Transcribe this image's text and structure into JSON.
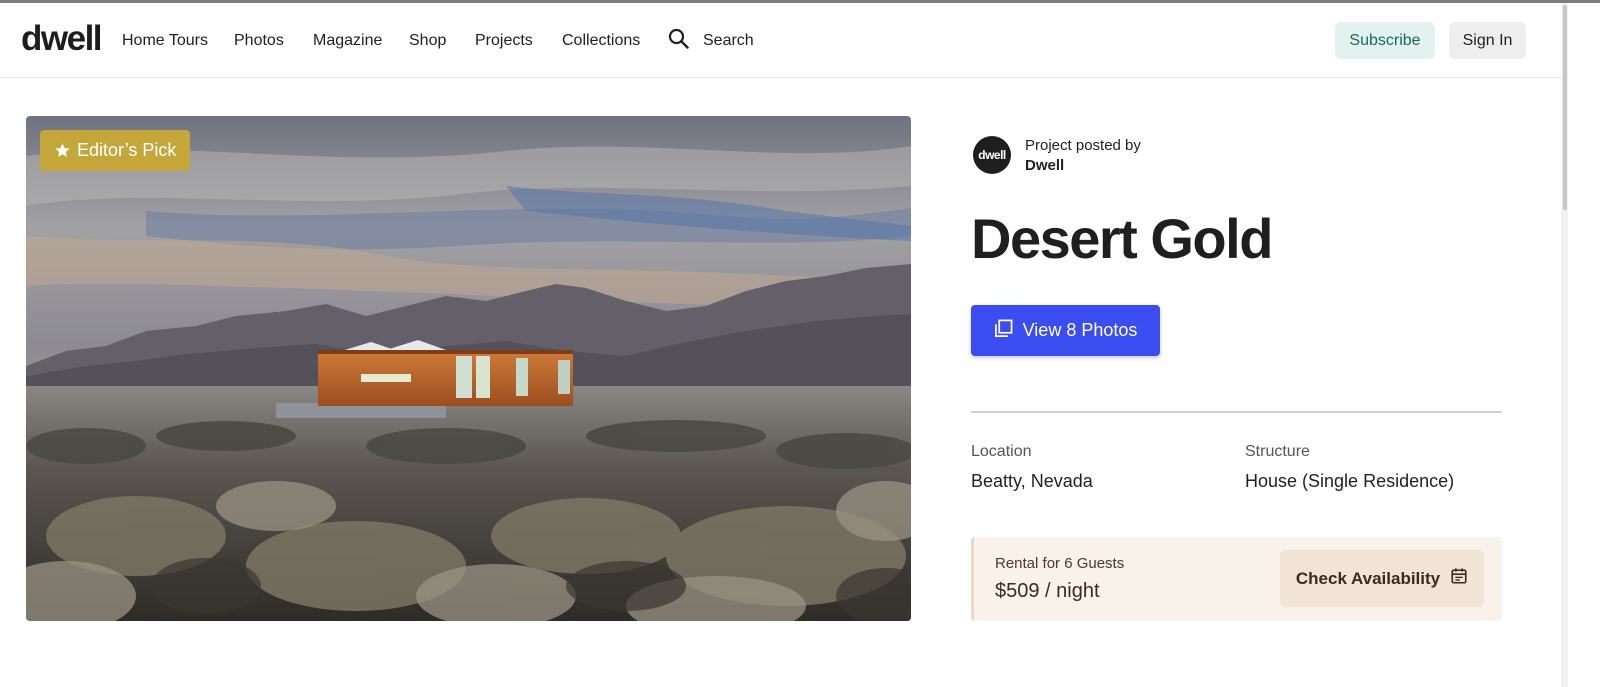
{
  "header": {
    "logo": "dwell",
    "nav": [
      "Home Tours",
      "Photos",
      "Magazine",
      "Shop",
      "Projects",
      "Collections"
    ],
    "search_label": "Search",
    "subscribe_label": "Subscribe",
    "signin_label": "Sign In"
  },
  "hero": {
    "badge_label": "Editor’s Pick",
    "badge_icon": "star-icon"
  },
  "author": {
    "avatar_text": "dwell",
    "posted_by": "Project posted by",
    "name": "Dwell"
  },
  "project": {
    "title": "Desert Gold",
    "view_photos_label": "View 8 Photos",
    "location_label": "Location",
    "location_value": "Beatty, Nevada",
    "structure_label": "Structure",
    "structure_value": "House (Single Residence)"
  },
  "rental": {
    "label": "Rental for 6 Guests",
    "price": "$509 / night",
    "check_label": "Check Availability",
    "check_icon": "calendar-icon"
  },
  "colors": {
    "accent_blue": "#3b4cf0",
    "badge_gold": "#c4a73b",
    "subscribe_bg": "#e4f2ef",
    "subscribe_text": "#17695f",
    "rental_bg": "#f8f2ea"
  }
}
